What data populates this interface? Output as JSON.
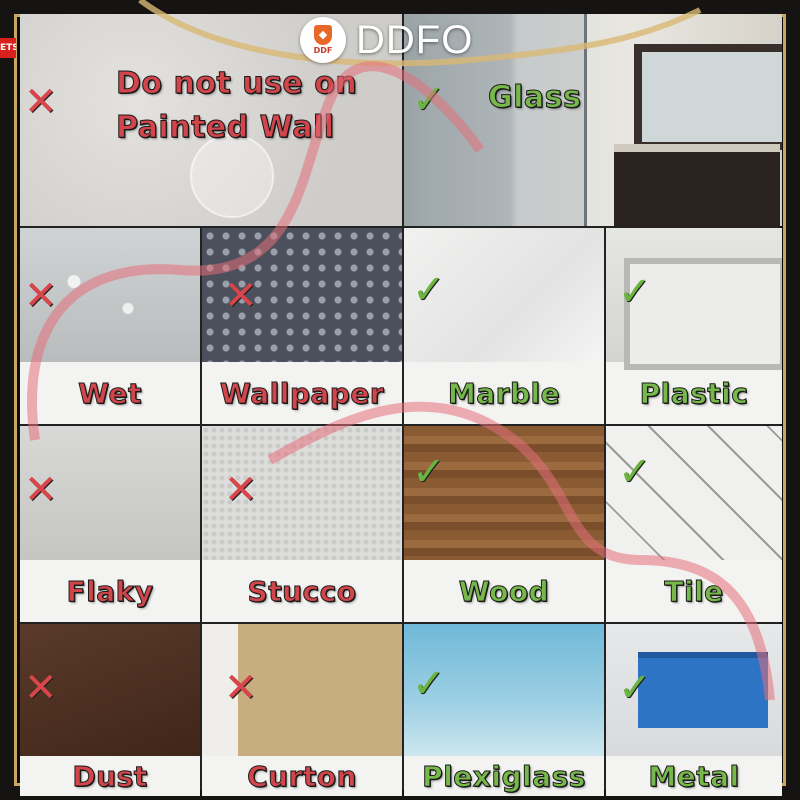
{
  "brand": {
    "name": "DDFO",
    "badge_text": "DDF"
  },
  "corner_tag": "ETS",
  "colors": {
    "bad": "#d2464b",
    "good": "#76b84a",
    "ribbon": "#e46f7a"
  },
  "tiles": {
    "painted_wall": {
      "label": "Do not use on Painted Wall",
      "line1": "Do not use on",
      "line2": "Painted Wall",
      "status": "bad",
      "mark": "✕"
    },
    "glass": {
      "label": "Glass",
      "status": "good",
      "mark": "✓"
    },
    "wet": {
      "label": "Wet",
      "status": "bad",
      "mark": "✕"
    },
    "wallpaper": {
      "label": "Wallpaper",
      "status": "bad",
      "mark": "✕"
    },
    "marble": {
      "label": "Marble",
      "status": "good",
      "mark": "✓"
    },
    "plastic": {
      "label": "Plastic",
      "status": "good",
      "mark": "✓"
    },
    "flaky": {
      "label": "Flaky",
      "status": "bad",
      "mark": "✕"
    },
    "stucco": {
      "label": "Stucco",
      "status": "bad",
      "mark": "✕"
    },
    "wood": {
      "label": "Wood",
      "status": "good",
      "mark": "✓"
    },
    "tile": {
      "label": "Tile",
      "status": "good",
      "mark": "✓"
    },
    "dust": {
      "label": "Dust",
      "status": "bad",
      "mark": "✕"
    },
    "curton": {
      "label": "Curton",
      "status": "bad",
      "mark": "✕"
    },
    "plexiglass": {
      "label": "Plexiglass",
      "status": "good",
      "mark": "✓"
    },
    "metal": {
      "label": "Metal",
      "status": "good",
      "mark": "✓"
    }
  }
}
